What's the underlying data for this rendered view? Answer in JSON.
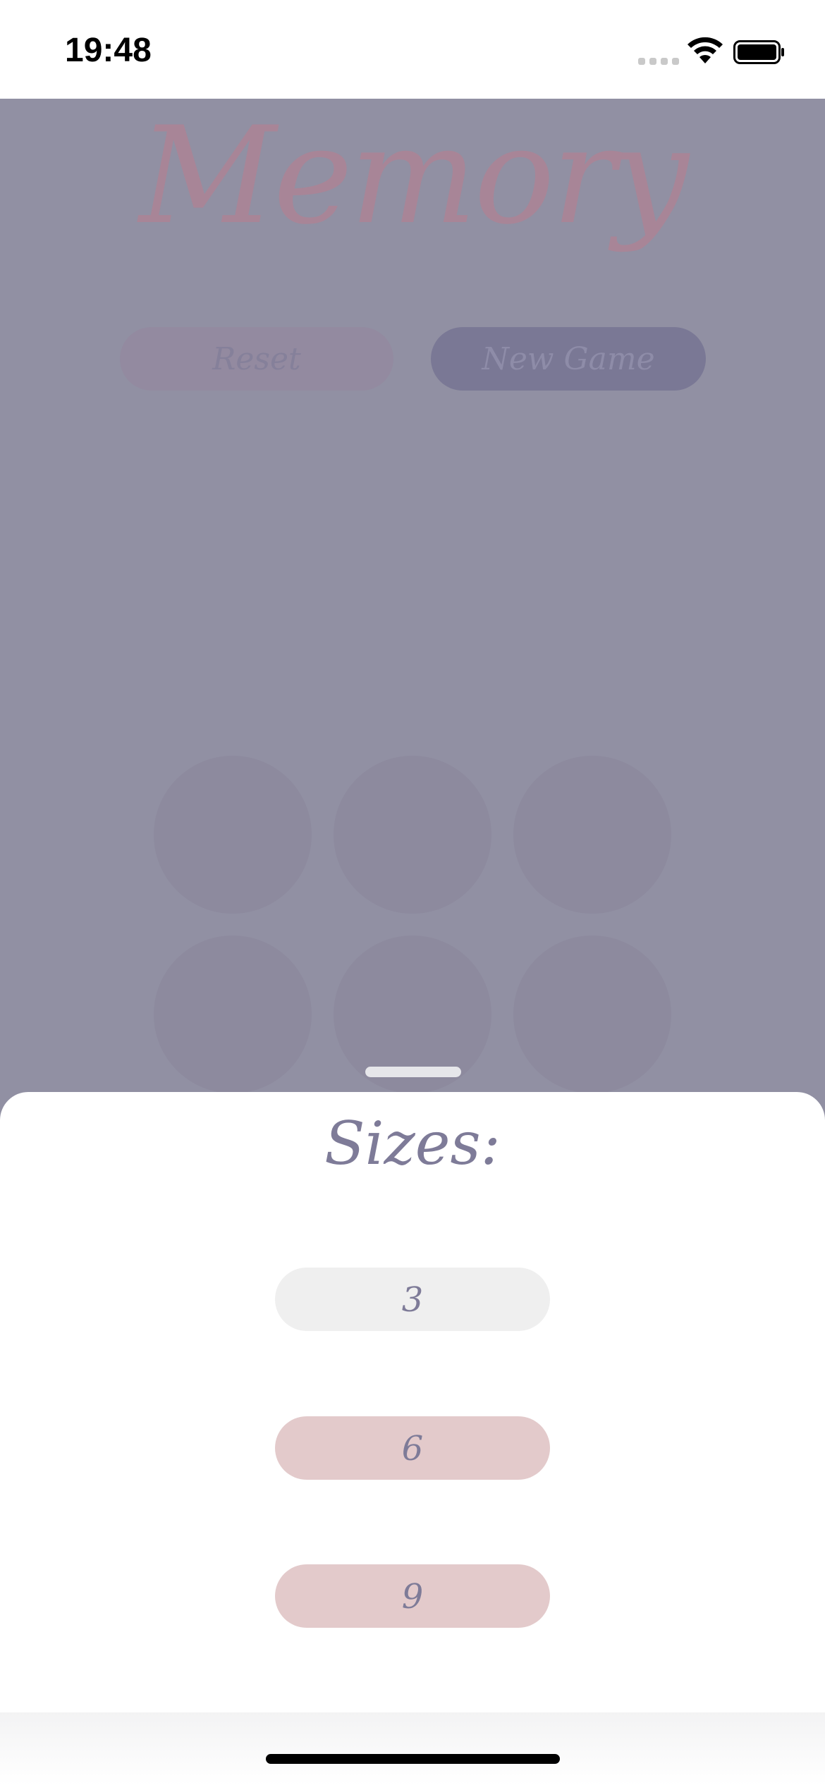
{
  "status_bar": {
    "time": "19:48",
    "icons": [
      "cellular-signal-icon",
      "wifi-icon",
      "battery-icon"
    ]
  },
  "app": {
    "title": "Memory",
    "reset_label": "Reset",
    "new_game_label": "New Game"
  },
  "cards": {
    "visible_count": 6,
    "rows": 2,
    "columns": 3,
    "state": "face-down"
  },
  "sheet": {
    "title": "Sizes:",
    "options": [
      {
        "label": "3",
        "state": "disabled"
      },
      {
        "label": "6",
        "state": "enabled"
      },
      {
        "label": "9",
        "state": "enabled"
      }
    ]
  },
  "colors": {
    "backdrop": "#9190a3",
    "title": "#a88597",
    "new_game_button": "#7a7895",
    "reset_button": "#938aa0",
    "sheet_text": "#7e7b98",
    "size_option_active": "#e3cacb",
    "size_option_disabled": "#efefef"
  }
}
